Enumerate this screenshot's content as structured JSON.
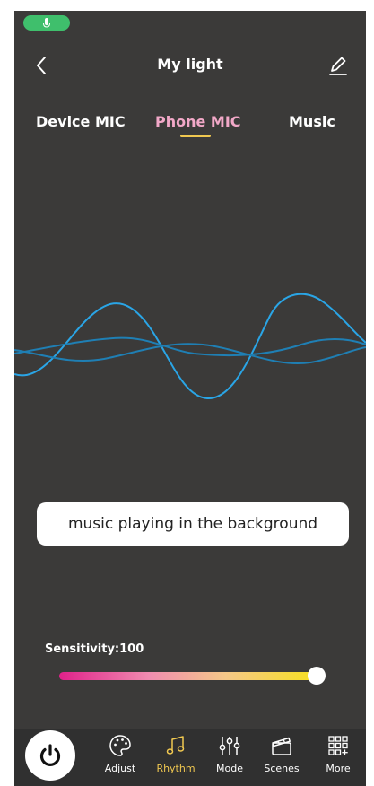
{
  "status_bar": {
    "mic_indicator": "mic-icon",
    "color": "#3fbf6c"
  },
  "header": {
    "title": "My light",
    "back_icon": "chevron-left-icon",
    "edit_icon": "pencil-icon"
  },
  "tabs": [
    {
      "label": "Device MIC",
      "active": false
    },
    {
      "label": "Phone MIC",
      "active": true
    },
    {
      "label": "Music",
      "active": false
    }
  ],
  "caption": {
    "text": "music playing in the background"
  },
  "sensitivity": {
    "label": "Sensitivity:100",
    "value": 100,
    "max": 100
  },
  "bottom_nav": {
    "power_icon": "power-icon",
    "items": [
      {
        "label": "Adjust",
        "icon": "palette-icon",
        "active": false
      },
      {
        "label": "Rhythm",
        "icon": "music-note-icon",
        "active": true
      },
      {
        "label": "Mode",
        "icon": "sliders-icon",
        "active": false
      },
      {
        "label": "Scenes",
        "icon": "clapperboard-icon",
        "active": false
      },
      {
        "label": "More",
        "icon": "grid-plus-icon",
        "active": false
      }
    ]
  },
  "colors": {
    "background": "#3b3a39",
    "accent_yellow": "#f0c850",
    "accent_pink": "#f2a8c8",
    "wave_blue": "#29a8e8"
  }
}
